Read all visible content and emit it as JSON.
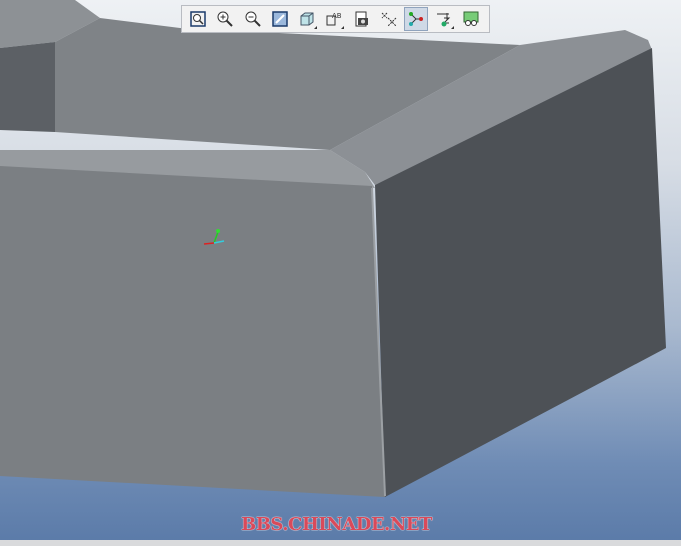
{
  "toolbar": {
    "buttons": [
      {
        "name": "refit-icon",
        "active": false
      },
      {
        "name": "zoom-in-icon",
        "active": false
      },
      {
        "name": "zoom-out-icon",
        "active": false
      },
      {
        "name": "repaint-icon",
        "active": false
      },
      {
        "name": "display-style-icon",
        "active": false,
        "dropdown": true
      },
      {
        "name": "annotation-display-icon",
        "active": false,
        "dropdown": true,
        "text": "AB"
      },
      {
        "name": "saved-views-icon",
        "active": false
      },
      {
        "name": "datum-display-icon",
        "active": false
      },
      {
        "name": "spin-center-icon",
        "active": true
      },
      {
        "name": "datum-planes-icon",
        "active": false,
        "dropdown": true
      },
      {
        "name": "view-manager-icon",
        "active": false
      }
    ]
  },
  "watermark": "BBS.CHINADE.NET",
  "colors": {
    "accent_active": "#cfd9e6",
    "watermark": "#d94a5a"
  }
}
